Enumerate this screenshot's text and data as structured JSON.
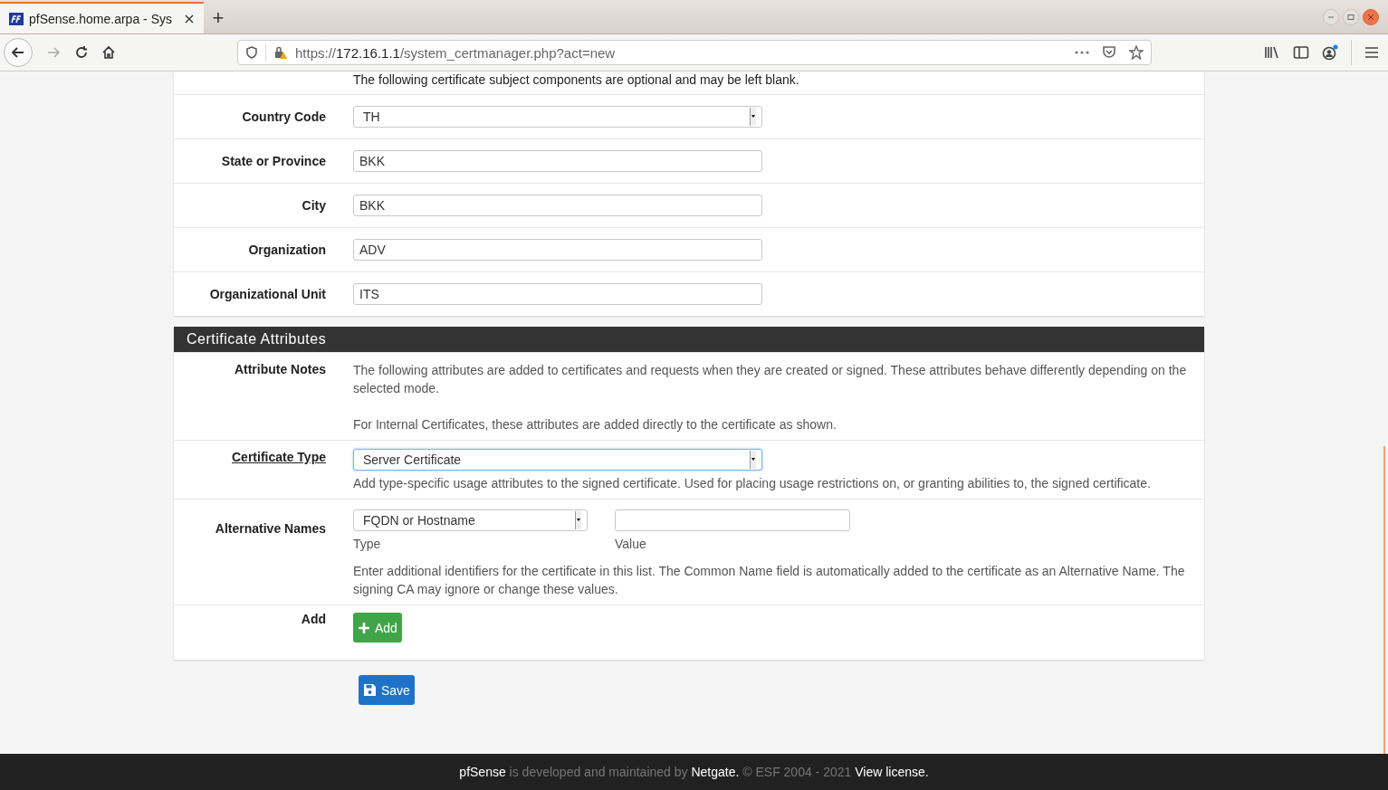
{
  "browser": {
    "tab_title": "pfSense.home.arpa - Sys",
    "url_scheme": "https://",
    "url_host": "172.16.1.1",
    "url_path": "/system_certmanager.php?act=new",
    "new_tab": "+"
  },
  "subject_panel": {
    "note": "The following certificate subject components are optional and may be left blank.",
    "fields": [
      {
        "label": "Country Code",
        "kind": "select",
        "value": "TH"
      },
      {
        "label": "State or Province",
        "kind": "text",
        "value": "BKK"
      },
      {
        "label": "City",
        "kind": "text",
        "value": "BKK"
      },
      {
        "label": "Organization",
        "kind": "text",
        "value": "ADV"
      },
      {
        "label": "Organizational Unit",
        "kind": "text",
        "value": "ITS"
      }
    ]
  },
  "attributes_panel": {
    "title": "Certificate Attributes",
    "attribute_notes": {
      "label": "Attribute Notes",
      "paragraphs": [
        "The following attributes are added to certificates and requests when they are created or signed. These attributes behave differently depending on the selected mode.",
        "For Internal Certificates, these attributes are added directly to the certificate as shown."
      ]
    },
    "certificate_type": {
      "label": "Certificate Type",
      "value": "Server Certificate",
      "help": "Add type-specific usage attributes to the signed certificate. Used for placing usage restrictions on, or granting abilities to, the signed certificate."
    },
    "alternative_names": {
      "label": "Alternative Names",
      "type_value": "FQDN or Hostname",
      "type_label": "Type",
      "value_label": "Value",
      "help": "Enter additional identifiers for the certificate in this list. The Common Name field is automatically added to the certificate as an Alternative Name. The signing CA may ignore or change these values."
    },
    "add": {
      "label": "Add",
      "button": "Add"
    }
  },
  "save_button": "Save",
  "footer": {
    "product": "pfSense",
    "text_1": "is developed and maintained by",
    "company": "Netgate.",
    "text_2": "© ESF 2004 - 2021",
    "license": "View license."
  }
}
